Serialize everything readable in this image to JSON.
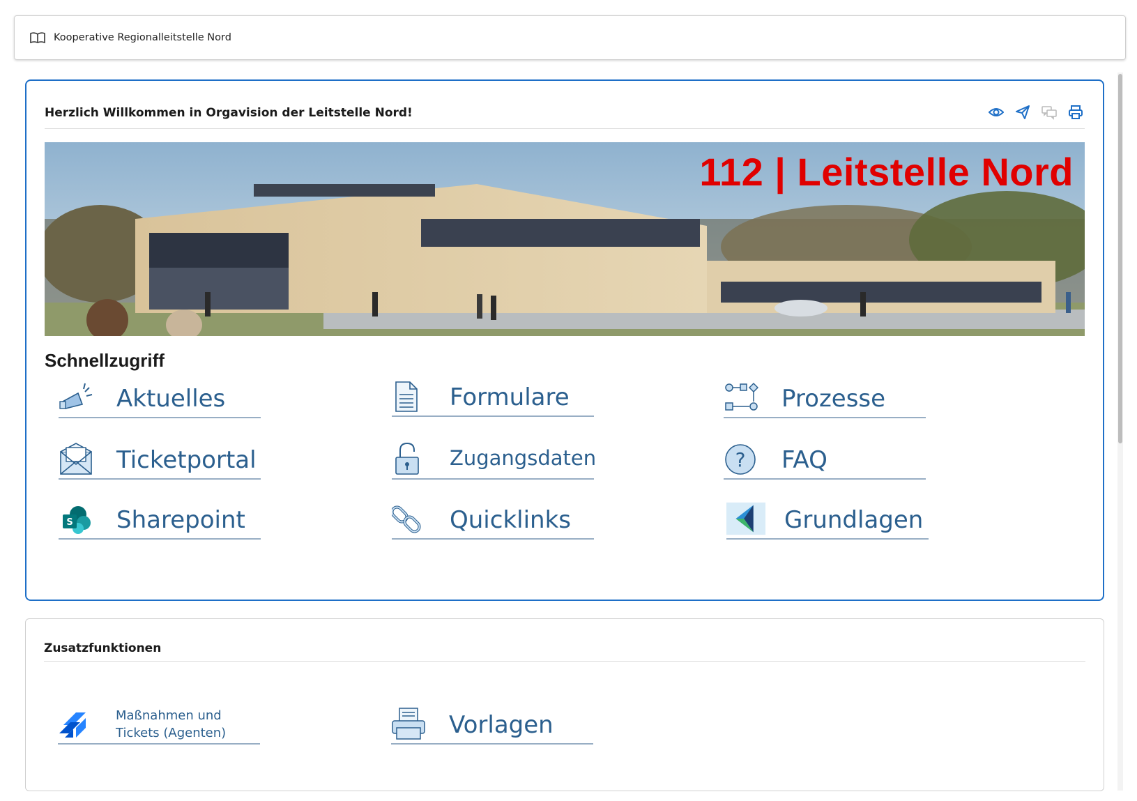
{
  "topbar": {
    "title": "Kooperative Regionalleitstelle Nord",
    "icon": "book-icon"
  },
  "welcome": {
    "title": "Herzlich Willkommen in Orgavision der Leitstelle Nord!",
    "actions": [
      "eye-icon",
      "send-icon",
      "comments-icon",
      "print-icon"
    ],
    "banner_text": "112 | Leitstelle Nord",
    "section_title": "Schnellzugriff",
    "tiles": [
      {
        "label": "Aktuelles",
        "icon": "megaphone-icon"
      },
      {
        "label": "Formulare",
        "icon": "document-icon"
      },
      {
        "label": "Prozesse",
        "icon": "process-flow-icon"
      },
      {
        "label": "Ticketportal",
        "icon": "envelope-icon"
      },
      {
        "label": "Zugangsdaten",
        "icon": "lock-icon"
      },
      {
        "label": "FAQ",
        "icon": "question-icon"
      },
      {
        "label": "Sharepoint",
        "icon": "sharepoint-icon"
      },
      {
        "label": "Quicklinks",
        "icon": "chain-link-icon"
      },
      {
        "label": "Grundlagen",
        "icon": "grundlagen-logo-icon"
      }
    ]
  },
  "extras": {
    "title": "Zusatzfunktionen",
    "tiles": [
      {
        "label": "Maßnahmen und Tickets (Agenten)",
        "icon": "jira-icon"
      },
      {
        "label": "Vorlagen",
        "icon": "printer-template-icon"
      }
    ]
  },
  "colors": {
    "accent": "#1e6fc7",
    "tile_text": "#2b5f8e",
    "banner_red": "#e00000"
  }
}
